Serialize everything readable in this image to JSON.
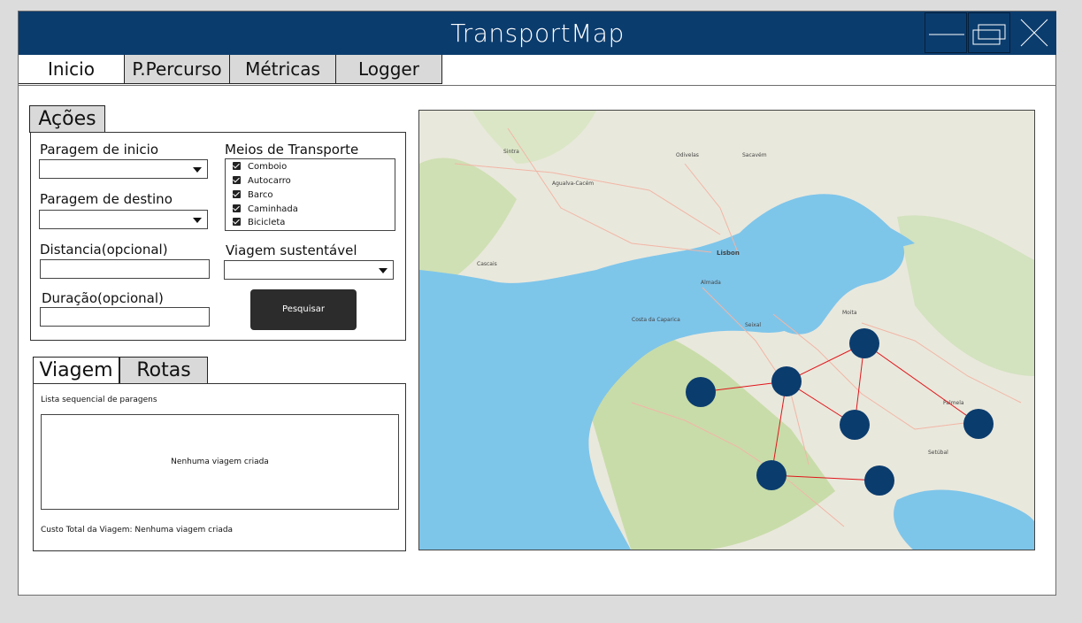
{
  "window": {
    "title": "TransportMap"
  },
  "tabs": [
    "Inicio",
    "P.Percurso",
    "Métricas",
    "Logger"
  ],
  "acoes": {
    "tab_label": "Ações",
    "start_label": "Paragem de inicio",
    "start_value": "",
    "dest_label": "Paragem de destino",
    "dest_value": "",
    "distance_label": "Distancia(opcional)",
    "distance_value": "",
    "duration_label": "Duração(opcional)",
    "duration_value": "",
    "transport_label": "Meios de Transporte",
    "transport_options": [
      {
        "label": "Comboio",
        "checked": true
      },
      {
        "label": "Autocarro",
        "checked": true
      },
      {
        "label": "Barco",
        "checked": true
      },
      {
        "label": "Caminhada",
        "checked": true
      },
      {
        "label": "Bicicleta",
        "checked": true
      }
    ],
    "sustainable_label": "Viagem sustentável",
    "sustainable_value": "",
    "search_button": "Pesquisar"
  },
  "trip": {
    "tabs": [
      "Viagem",
      "Rotas"
    ],
    "list_label": "Lista sequencial de paragens",
    "empty_message": "Nenhuma viagem criada",
    "total_cost_label": "Custo Total da Viagem: Nenhuma viagem criada"
  },
  "map": {
    "labels": {
      "sintra": "Sintra",
      "odivelas": "Odivelas",
      "sacavem": "Sacavém",
      "agualva": "Agualva-Cacém",
      "lisbon": "Lisbon",
      "almada": "Almada",
      "cascais": "Cascais",
      "seixal": "Seixal",
      "moita": "Moita",
      "palmela": "Palmela",
      "setubal": "Setúbal",
      "costa": "Costa da Caparica"
    },
    "colors": {
      "node": "#0b3c6e",
      "edge": "#e0161b",
      "water": "#7ec5ea",
      "land": "#e9e8dc",
      "green": "#bfd8a2"
    }
  }
}
